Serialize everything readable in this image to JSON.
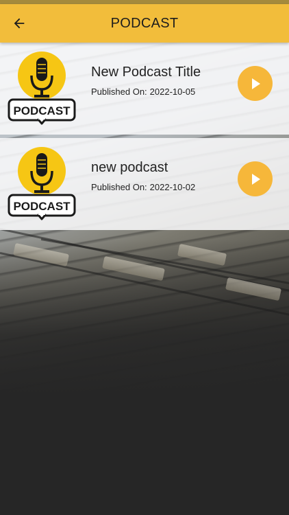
{
  "header": {
    "title": "PODCAST",
    "back_icon": "arrow-left-icon",
    "background_color": "#f2bd3b"
  },
  "episodes": [
    {
      "title": "New Podcast Title",
      "published_label": "Published On:",
      "published_date": "2022-10-05",
      "thumbnail_text": "PODCAST",
      "play_icon": "play-icon"
    },
    {
      "title": "new podcast",
      "published_label": "Published On:",
      "published_date": "2022-10-02",
      "thumbnail_text": "PODCAST",
      "play_icon": "play-icon"
    }
  ],
  "colors": {
    "accent": "#f6b73a",
    "logo_yellow": "#f6c614",
    "page_bg": "#262626"
  }
}
